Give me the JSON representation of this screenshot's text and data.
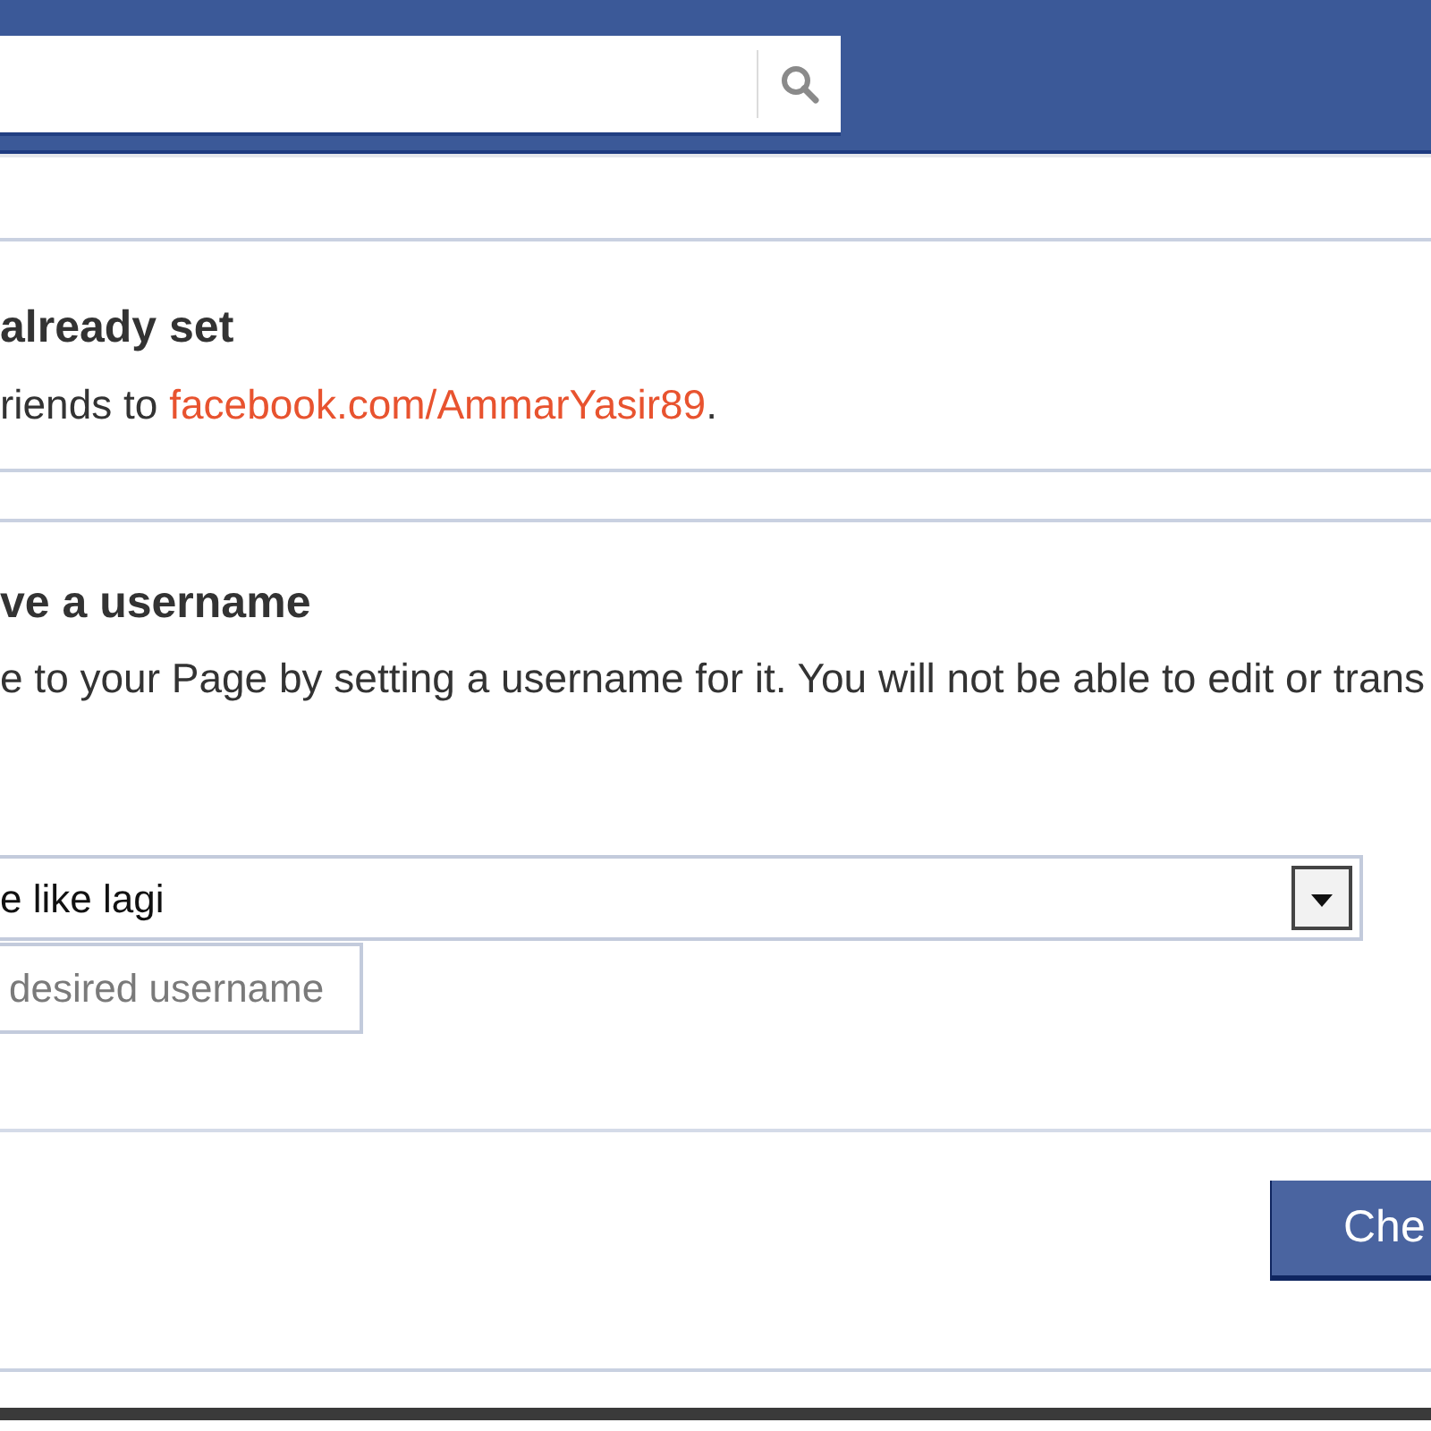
{
  "username_notice": {
    "heading": "already set",
    "text_before": "riends to ",
    "link": "facebook.com/AmmarYasir89",
    "text_after": "."
  },
  "set_username": {
    "heading": "ve a username",
    "description": "e to your Page by setting a username for it. You will not be able to edit or trans",
    "page_select": {
      "value": "e like lagi"
    },
    "username_field": {
      "placeholder": "desired username"
    }
  },
  "footer": {
    "button": "Che"
  }
}
